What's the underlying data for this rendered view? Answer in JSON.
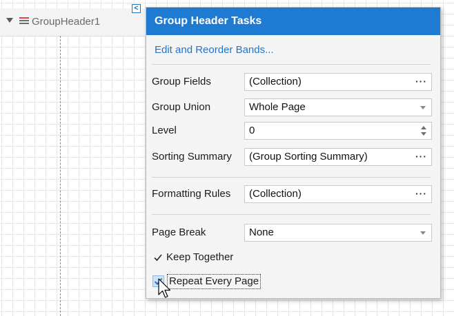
{
  "band": {
    "name": "GroupHeader1",
    "smart_tag_glyph": "<"
  },
  "panel": {
    "title": "Group Header Tasks",
    "link": "Edit and Reorder Bands...",
    "properties": {
      "group_fields": {
        "label": "Group Fields",
        "value": "(Collection)",
        "button": "···"
      },
      "group_union": {
        "label": "Group Union",
        "value": "Whole Page"
      },
      "level": {
        "label": "Level",
        "value": "0"
      },
      "sorting_summary": {
        "label": "Sorting Summary",
        "value": "(Group Sorting Summary)",
        "button": "···"
      },
      "formatting_rules": {
        "label": "Formatting Rules",
        "value": "(Collection)",
        "button": "···"
      },
      "page_break": {
        "label": "Page Break",
        "value": "None"
      }
    },
    "checkboxes": {
      "keep_together": {
        "label": "Keep Together",
        "checked": true
      },
      "repeat_every_page": {
        "label": "Repeat Every Page",
        "checked": true
      }
    }
  },
  "colors": {
    "title_bar": "#1f7ad1",
    "link": "#1f73c9",
    "check_accent": "#1f74c5"
  }
}
